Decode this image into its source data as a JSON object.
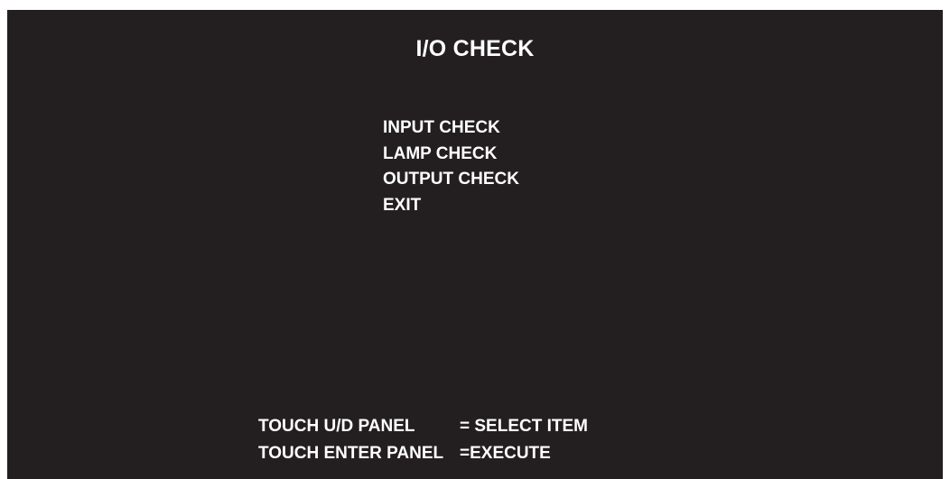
{
  "screen": {
    "title": "I/O CHECK"
  },
  "menu": {
    "items": [
      {
        "label": "INPUT CHECK"
      },
      {
        "label": "LAMP CHECK"
      },
      {
        "label": "OUTPUT CHECK"
      },
      {
        "label": "EXIT"
      }
    ]
  },
  "help": {
    "rows": [
      {
        "key": "TOUCH U/D PANEL",
        "action": "= SELECT ITEM"
      },
      {
        "key": "TOUCH ENTER PANEL",
        "action": "=EXECUTE"
      }
    ]
  },
  "colors": {
    "background": "#231f20",
    "text": "#ffffff"
  }
}
